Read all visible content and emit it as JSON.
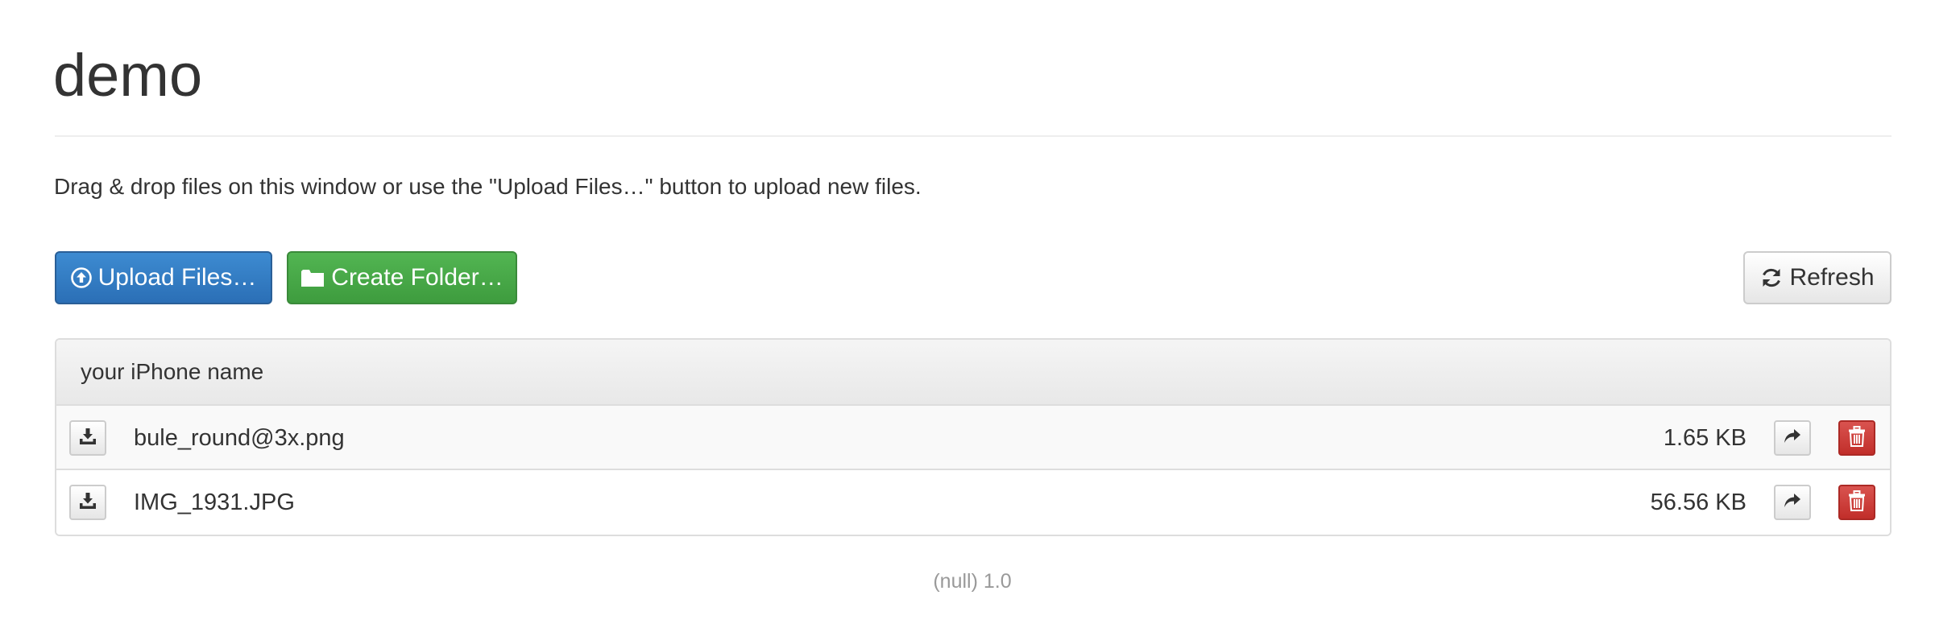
{
  "page": {
    "title": "demo",
    "instructions": "Drag & drop files on this window or use the \"Upload Files…\" button to upload new files."
  },
  "toolbar": {
    "upload_label": "Upload Files…",
    "upload_icon": "circle-arrow-up-icon",
    "create_folder_label": "Create Folder…",
    "create_folder_icon": "folder-icon",
    "refresh_label": "Refresh",
    "refresh_icon": "refresh-icon"
  },
  "panel": {
    "heading": "your iPhone name",
    "files": [
      {
        "name": "bule_round@3x.png",
        "size": "1.65 KB"
      },
      {
        "name": "IMG_1931.JPG",
        "size": "56.56 KB"
      }
    ]
  },
  "footer": {
    "text": "(null) 1.0"
  },
  "colors": {
    "primary": "#337ab7",
    "success": "#449d44",
    "danger": "#d9534f",
    "text": "#333333",
    "muted": "#999999"
  }
}
